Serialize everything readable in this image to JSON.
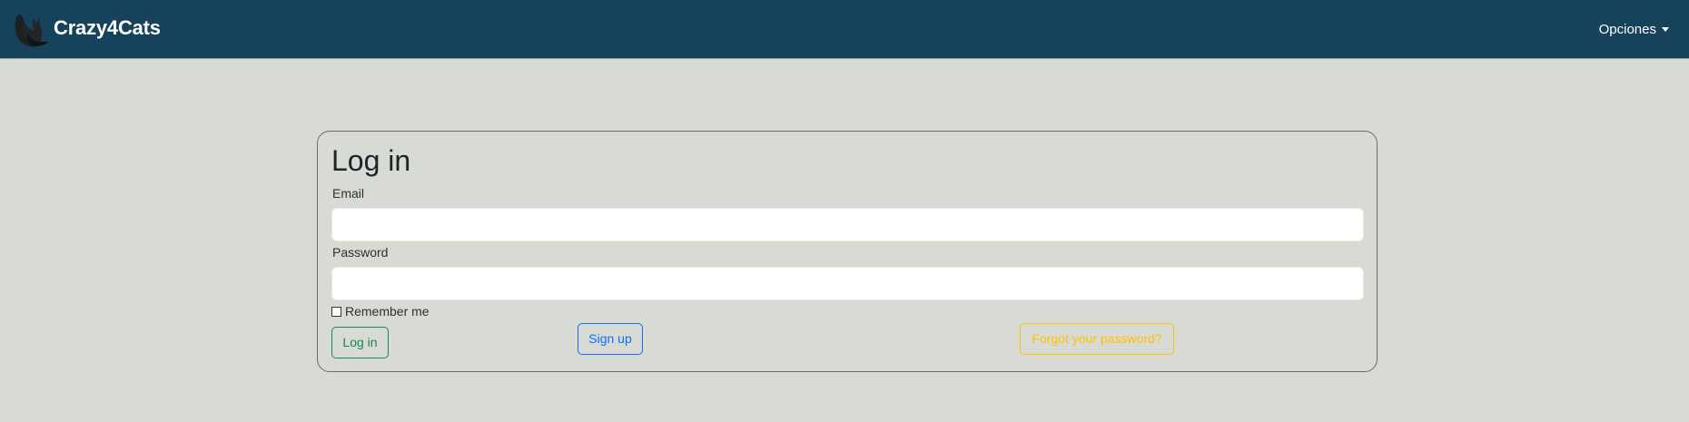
{
  "navbar": {
    "brand": "Crazy4Cats",
    "options_label": "Opciones"
  },
  "login": {
    "title": "Log in",
    "email_label": "Email",
    "email_value": "",
    "password_label": "Password",
    "password_value": "",
    "remember_label": "Remember me",
    "remember_checked": false,
    "login_button": "Log in",
    "signup_button": "Sign up",
    "forgot_button": "Forgot your password?"
  },
  "colors": {
    "navbar_bg": "#17425c",
    "page_bg": "#d8dad4",
    "login_button": "#198754",
    "signup_button": "#0d6efd",
    "forgot_button": "#ffc107"
  },
  "icons": {
    "brand_logo": "cat-silhouette-icon",
    "options_caret": "caret-down-icon"
  }
}
